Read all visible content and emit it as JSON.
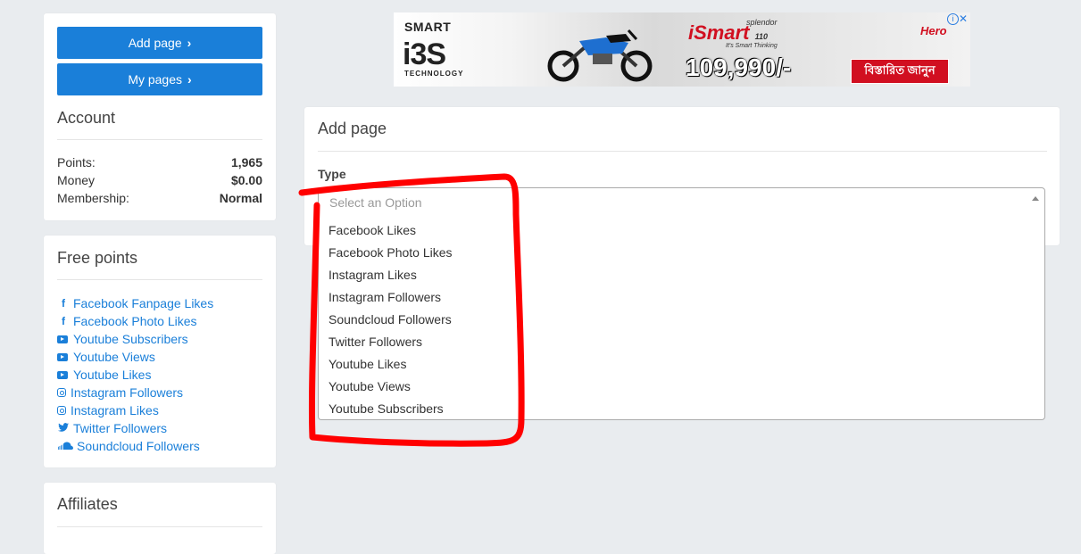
{
  "sidebar": {
    "add_page_label": "Add page",
    "my_pages_label": "My pages",
    "account": {
      "title": "Account",
      "points_label": "Points:",
      "points_value": "1,965",
      "money_label": "Money",
      "money_value": "$0.00",
      "membership_label": "Membership:",
      "membership_value": "Normal"
    },
    "free_points": {
      "title": "Free points",
      "items": [
        {
          "label": "Facebook Fanpage Likes",
          "icon": "facebook-icon"
        },
        {
          "label": "Facebook Photo Likes",
          "icon": "facebook-icon"
        },
        {
          "label": "Youtube Subscribers",
          "icon": "youtube-icon"
        },
        {
          "label": "Youtube Views",
          "icon": "youtube-icon"
        },
        {
          "label": "Youtube Likes",
          "icon": "youtube-icon"
        },
        {
          "label": "Instagram Followers",
          "icon": "instagram-icon"
        },
        {
          "label": "Instagram Likes",
          "icon": "instagram-icon"
        },
        {
          "label": "Twitter Followers",
          "icon": "twitter-icon"
        },
        {
          "label": "Soundcloud Followers",
          "icon": "soundcloud-icon"
        }
      ]
    },
    "affiliates": {
      "title": "Affiliates"
    }
  },
  "ad": {
    "brand_top": "SMART",
    "brand_main": "i3S",
    "brand_bottom": "TECHNOLOGY",
    "model_prefix": "splendor",
    "model": "iSmart",
    "model_suffix": "110",
    "tagline": "It's Smart Thinking",
    "price": "109,990/-",
    "cta": "বিস্তারিত জানুন",
    "logo": "Hero"
  },
  "main": {
    "title": "Add page",
    "type_label": "Type",
    "select_placeholder": "Select an Option",
    "options": [
      "Facebook Likes",
      "Facebook Photo Likes",
      "Instagram Likes",
      "Instagram Followers",
      "Soundcloud Followers",
      "Twitter Followers",
      "Youtube Likes",
      "Youtube Views",
      "Youtube Subscribers"
    ]
  },
  "colors": {
    "primary": "#1a7fd9",
    "background": "#e9ecef",
    "annotation": "#ff0000"
  }
}
